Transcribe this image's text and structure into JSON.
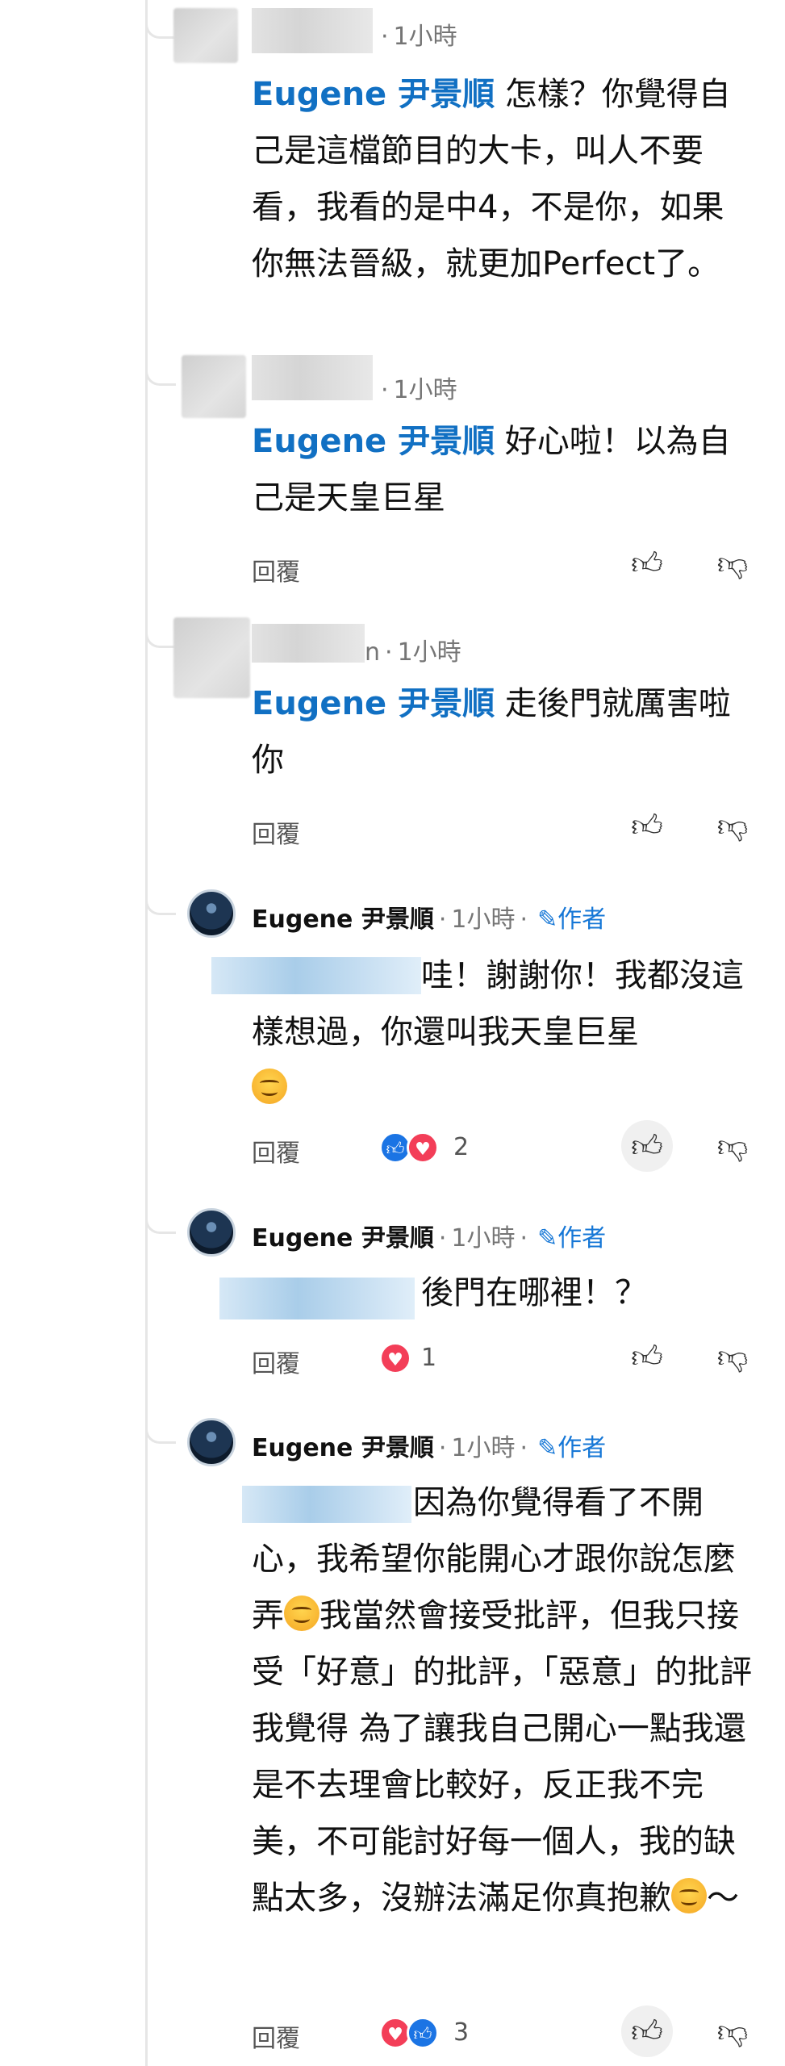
{
  "comments": [
    {
      "time": "1小時",
      "mention": "Eugene 尹景順",
      "text": " 怎樣？你覺得自己是這檔節目的大卡，叫人不要看，我看的是中4，不是你，如果你無法晉級，就更加Perfect了。"
    },
    {
      "time": "1小時",
      "mention": "Eugene 尹景順",
      "text": " 好心啦！以為自己是天皇巨星",
      "reply": "回覆"
    },
    {
      "name_suffix": "n",
      "time": "1小時",
      "mention": "Eugene 尹景順",
      "text": " 走後門就厲害啦你",
      "reply": "回覆"
    },
    {
      "author": "Eugene 尹景順",
      "time": "1小時",
      "badge": "作者",
      "text": "哇！謝謝你！我都沒這樣想過，你還叫我天皇巨星",
      "reply": "回覆",
      "reaction_count": "2"
    },
    {
      "author": "Eugene 尹景順",
      "time": "1小時",
      "badge": "作者",
      "text": "後門在哪裡！？",
      "reply": "回覆",
      "reaction_count": "1"
    },
    {
      "author": "Eugene 尹景順",
      "time": "1小時",
      "badge": "作者",
      "text_part1": " 因為你覺得看了不開心，我希望你能開心才跟你說怎麼弄",
      "text_part2": "我當然會接受批評，但我只接受「好意」的批評，「惡意」的批評 我覺得 為了讓我自己開心一點我還是不去理會比較好，反正我不完美，不可能討好每一個人，我的缺點太多，沒辦法滿足你真抱歉",
      "text_part3": "～",
      "reply": "回覆",
      "reaction_count": "3"
    }
  ],
  "icons": {
    "thumb_up": "thumbs-up-icon",
    "thumb_down": "thumbs-down-icon",
    "pen": "pen-icon",
    "like_reaction": "like-reaction-icon",
    "heart_reaction": "heart-reaction-icon",
    "emoji": "smiling-face-emoji"
  },
  "colors": {
    "mention": "#1170c3",
    "author_badge": "#1677d6",
    "like": "#1b74e4",
    "heart": "#f33e58"
  }
}
